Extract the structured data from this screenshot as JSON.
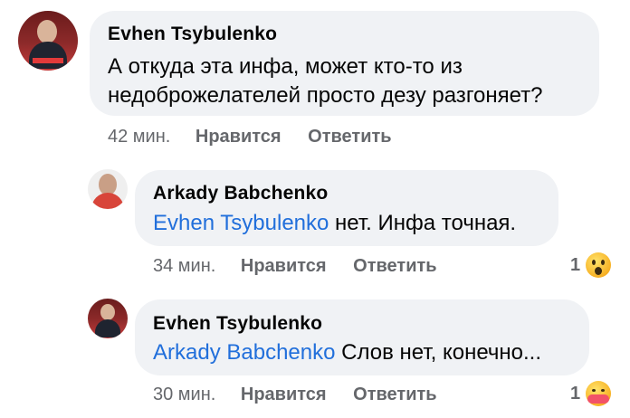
{
  "comments": [
    {
      "author": "Evhen Tsybulenko",
      "text_line1": "А откуда эта инфа, может кто-то из",
      "text_line2": "недоброжелателей просто дезу разгоняет?",
      "time": "42 мин.",
      "like_label": "Нравится",
      "reply_label": "Ответить"
    },
    {
      "author": "Arkady Babchenko",
      "mention": "Evhen Tsybulenko",
      "text": "нет. Инфа точная.",
      "time": "34 мин.",
      "like_label": "Нравится",
      "reply_label": "Ответить",
      "reaction_count": "1",
      "reaction_icon": "wow-emoji-icon"
    },
    {
      "author": "Evhen Tsybulenko",
      "mention": "Arkady Babchenko",
      "text": "Слов нет, конечно...",
      "time": "30 мин.",
      "like_label": "Нравится",
      "reply_label": "Ответить",
      "reaction_count": "1",
      "reaction_icon": "care-emoji-icon"
    }
  ],
  "colors": {
    "bubble": "#f0f2f5",
    "mention": "#216fdb",
    "meta": "#65676b",
    "text": "#050505"
  }
}
